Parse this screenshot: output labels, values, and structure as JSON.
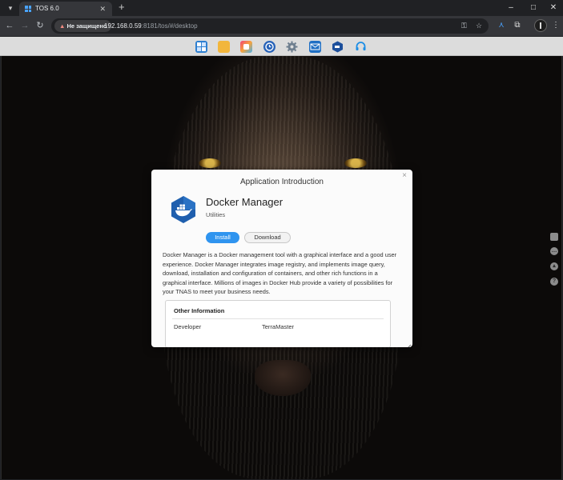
{
  "browser": {
    "tab_title": "TOS 6.0",
    "tab_close": "✕",
    "new_tab": "+",
    "security_label": "Не защищено",
    "url_host": "192.168.0.59",
    "url_rest": ":8181/tos/#/desktop",
    "window_minimize": "–",
    "window_maximize": "□",
    "window_close": "✕"
  },
  "dock": {
    "icons": [
      "desktop-icon",
      "folder-icon",
      "app-center-icon",
      "clock-icon",
      "settings-gear-icon",
      "mail-icon",
      "docker-icon",
      "support-headset-icon"
    ],
    "colors": {
      "blue": "#2d7fd0",
      "folder": "#f2b63c",
      "accent": "#2f94ef"
    }
  },
  "side_icons": [
    "monitor-icon",
    "chat-icon",
    "bell-icon",
    "help-icon"
  ],
  "dialog": {
    "title": "Application Introduction",
    "close": "×",
    "app_name": "Docker Manager",
    "category": "Utilities",
    "install_label": "Install",
    "download_label": "Download",
    "description": "Docker Manager is a Docker management tool with a graphical interface and a good user experience. Docker Manager integrates image registry, and implements image query, download, installation and configuration of containers, and other rich functions in a graphical interface. Millions of images in Docker Hub provide a variety of possibilities for your TNAS to meet your business needs.",
    "other_info": {
      "heading": "Other Information",
      "rows": [
        {
          "key": "Developer",
          "value": "TerraMaster"
        }
      ]
    }
  }
}
